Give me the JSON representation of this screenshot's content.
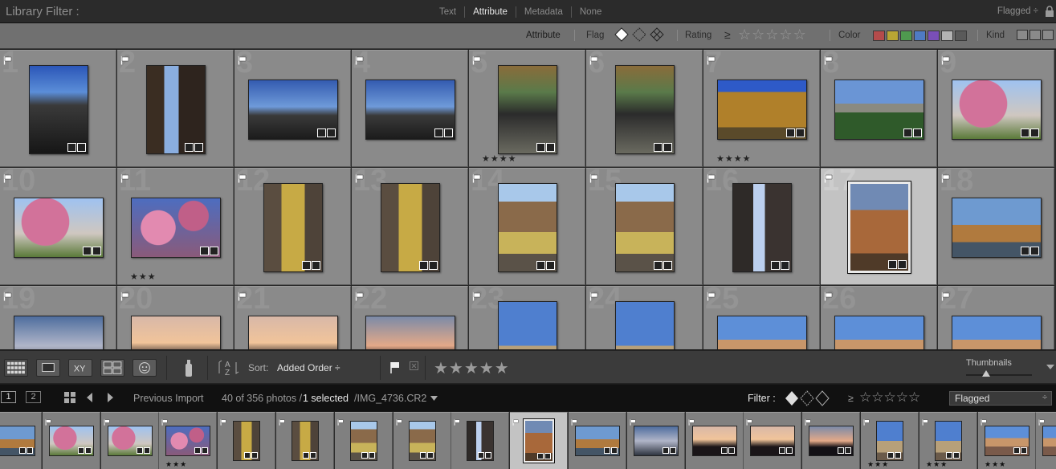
{
  "filter_bar": {
    "title": "Library Filter :",
    "tabs": [
      {
        "label": "Text",
        "active": false
      },
      {
        "label": "Attribute",
        "active": true
      },
      {
        "label": "Metadata",
        "active": false
      },
      {
        "label": "None",
        "active": false
      }
    ],
    "preset": "Flagged ÷"
  },
  "attribute_bar": {
    "attribute_label": "Attribute",
    "flag_label": "Flag",
    "rating_label": "Rating",
    "rating_op": "≥",
    "color_label": "Color",
    "kind_label": "Kind",
    "colors": [
      "#b44b4b",
      "#b8a634",
      "#4f9a4f",
      "#4f7bc4",
      "#7a4fb8",
      "#b3b3b3",
      "#5a5a5a"
    ]
  },
  "grid": {
    "cells": [
      {
        "num": "1",
        "photo": "p-tower",
        "orient": "p",
        "stars": ""
      },
      {
        "num": "2",
        "photo": "p-street",
        "orient": "p",
        "stars": ""
      },
      {
        "num": "3",
        "photo": "p-square",
        "orient": "l",
        "stars": ""
      },
      {
        "num": "4",
        "photo": "p-square",
        "orient": "l",
        "stars": ""
      },
      {
        "num": "5",
        "photo": "p-player",
        "orient": "p",
        "stars": "★★★★"
      },
      {
        "num": "6",
        "photo": "p-player",
        "orient": "p",
        "stars": ""
      },
      {
        "num": "7",
        "photo": "p-building",
        "orient": "l",
        "stars": "★★★★"
      },
      {
        "num": "8",
        "photo": "p-park",
        "orient": "l",
        "stars": ""
      },
      {
        "num": "9",
        "photo": "p-blossom",
        "orient": "l",
        "stars": ""
      },
      {
        "num": "10",
        "photo": "p-blossom",
        "orient": "l",
        "stars": ""
      },
      {
        "num": "11",
        "photo": "p-blossom2",
        "orient": "l",
        "stars": "★★★"
      },
      {
        "num": "12",
        "photo": "p-angel",
        "orient": "p",
        "stars": ""
      },
      {
        "num": "13",
        "photo": "p-angel",
        "orient": "p",
        "stars": ""
      },
      {
        "num": "14",
        "photo": "p-golden",
        "orient": "p",
        "stars": ""
      },
      {
        "num": "15",
        "photo": "p-golden",
        "orient": "p",
        "stars": ""
      },
      {
        "num": "16",
        "photo": "p-alley",
        "orient": "p",
        "stars": ""
      },
      {
        "num": "17",
        "photo": "p-castle",
        "orient": "p",
        "stars": "",
        "selected": true
      },
      {
        "num": "18",
        "photo": "p-riverc",
        "orient": "l",
        "stars": ""
      },
      {
        "num": "19",
        "photo": "p-dusk",
        "orient": "l",
        "stars": ""
      },
      {
        "num": "20",
        "photo": "p-sunset",
        "orient": "l",
        "stars": ""
      },
      {
        "num": "21",
        "photo": "p-sunset",
        "orient": "l",
        "stars": ""
      },
      {
        "num": "22",
        "photo": "p-sunset2",
        "orient": "l",
        "stars": ""
      },
      {
        "num": "23",
        "photo": "p-spire",
        "orient": "p",
        "stars": ""
      },
      {
        "num": "24",
        "photo": "p-spire",
        "orient": "p",
        "stars": ""
      },
      {
        "num": "25",
        "photo": "p-panorama",
        "orient": "l",
        "stars": ""
      },
      {
        "num": "26",
        "photo": "p-panorama",
        "orient": "l",
        "stars": ""
      },
      {
        "num": "27",
        "photo": "p-panorama",
        "orient": "l",
        "stars": ""
      }
    ]
  },
  "toolbar": {
    "sort_label": "Sort:",
    "sort_value": "Added Order ÷",
    "thumbnails_label": "Thumbnails",
    "thumbnail_size": 0.3
  },
  "filmstrip_header": {
    "page1": "1",
    "page2": "2",
    "source": "Previous Import",
    "count": "40 of 356 photos /",
    "selected": "1 selected",
    "filename": "/IMG_4736.CR2",
    "filter_label": "Filter :",
    "rating_op": "≥",
    "filter_preset": "Flagged"
  },
  "filmstrip": [
    {
      "photo": "p-riverc",
      "orient": "l",
      "stars": ""
    },
    {
      "photo": "p-blossom",
      "orient": "l",
      "stars": ""
    },
    {
      "photo": "p-blossom",
      "orient": "l",
      "stars": ""
    },
    {
      "photo": "p-blossom2",
      "orient": "l",
      "stars": "★★★"
    },
    {
      "photo": "p-angel",
      "orient": "p",
      "stars": ""
    },
    {
      "photo": "p-angel",
      "orient": "p",
      "stars": ""
    },
    {
      "photo": "p-golden",
      "orient": "p",
      "stars": ""
    },
    {
      "photo": "p-golden",
      "orient": "p",
      "stars": ""
    },
    {
      "photo": "p-alley",
      "orient": "p",
      "stars": ""
    },
    {
      "photo": "p-castle",
      "orient": "p",
      "stars": "",
      "selected": true
    },
    {
      "photo": "p-riverc",
      "orient": "l",
      "stars": ""
    },
    {
      "photo": "p-dusk",
      "orient": "l",
      "stars": ""
    },
    {
      "photo": "p-sunset",
      "orient": "l",
      "stars": ""
    },
    {
      "photo": "p-sunset",
      "orient": "l",
      "stars": ""
    },
    {
      "photo": "p-sunset2",
      "orient": "l",
      "stars": ""
    },
    {
      "photo": "p-spire",
      "orient": "p",
      "stars": "★★★"
    },
    {
      "photo": "p-spire",
      "orient": "p",
      "stars": "★★★"
    },
    {
      "photo": "p-panorama",
      "orient": "l",
      "stars": "★★★"
    },
    {
      "photo": "p-panorama",
      "orient": "l",
      "stars": ""
    }
  ]
}
